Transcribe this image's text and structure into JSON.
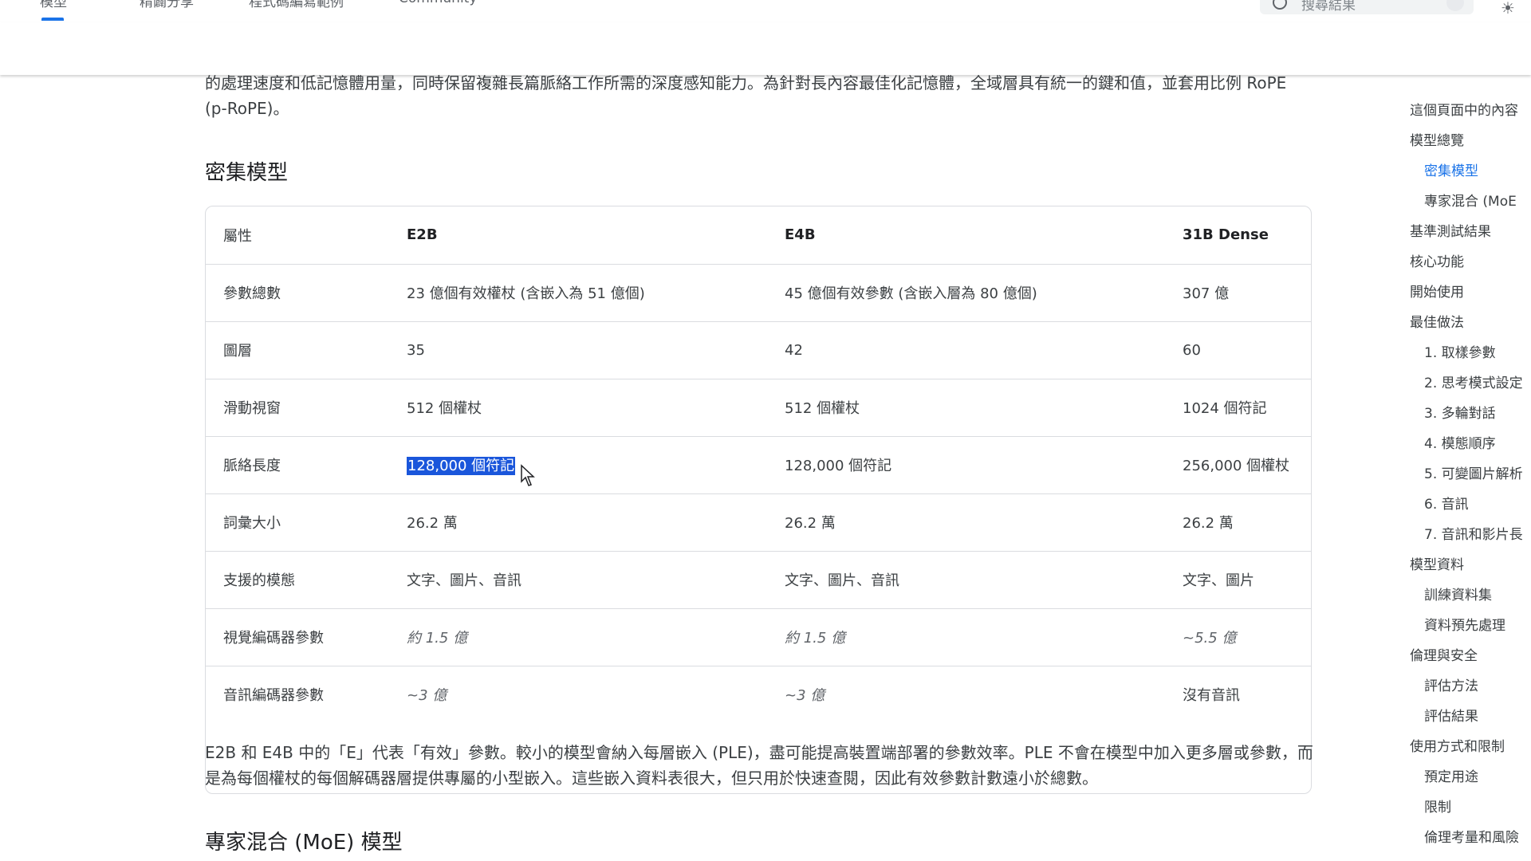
{
  "topnav": {
    "tabs": [
      "模型",
      "精闢分享",
      "程式碼編寫範例",
      "Community"
    ],
    "search_placeholder": "搜尋結果"
  },
  "content": {
    "intro_para": "的處理速度和低記憶體用量，同時保留複雜長篇脈絡工作所需的深度感知能力。為針對長內容最佳化記憶體，全域層具有統一的鍵和值，並套用比例 RoPE (p-RoPE)。",
    "dense_heading": "密集模型",
    "table": {
      "headers": [
        "屬性",
        "E2B",
        "E4B",
        "31B Dense"
      ],
      "rows": [
        [
          "參數總數",
          "23 億個有效權杖 (含嵌入為 51 億個)",
          "45 億個有效參數 (含嵌入層為 80 億個)",
          "307 億"
        ],
        [
          "圖層",
          "35",
          "42",
          "60"
        ],
        [
          "滑動視窗",
          "512 個權杖",
          "512 個權杖",
          "1024 個符記"
        ],
        [
          "脈絡長度",
          "128,000 個符記",
          "128,000 個符記",
          "256,000 個權杖"
        ],
        [
          "詞彙大小",
          "26.2 萬",
          "26.2 萬",
          "26.2 萬"
        ],
        [
          "支援的模態",
          "文字、圖片、音訊",
          "文字、圖片、音訊",
          "文字、圖片"
        ],
        [
          "視覺編碼器參數",
          "約 1.5 億",
          "約 1.5 億",
          "~5.5 億"
        ],
        [
          "音訊編碼器參數",
          "~3 億",
          "~3 億",
          "沒有音訊"
        ]
      ]
    },
    "e_note": "E2B 和 E4B 中的「E」代表「有效」參數。較小的模型會納入每層嵌入 (PLE)，盡可能提高裝置端部署的參數效率。PLE 不會在模型中加入更多層或參數，而是為每個權杖的每個解碼器層提供專屬的小型嵌入。這些嵌入資料表很大，但只用於快速查閱，因此有效參數計數遠小於總數。",
    "moe_heading": "專家混合 (MoE) 模型"
  },
  "toc": {
    "title": "這個頁面中的內容",
    "items": [
      {
        "label": "模型總覽",
        "level": 0
      },
      {
        "label": "密集模型",
        "level": 1,
        "active": true
      },
      {
        "label": "專家混合 (MoE",
        "level": 1
      },
      {
        "label": "基準測試結果",
        "level": 0
      },
      {
        "label": "核心功能",
        "level": 0
      },
      {
        "label": "開始使用",
        "level": 0
      },
      {
        "label": "最佳做法",
        "level": 0
      },
      {
        "label": "1. 取樣參數",
        "level": 1
      },
      {
        "label": "2. 思考模式設定",
        "level": 1
      },
      {
        "label": "3. 多輪對話",
        "level": 1
      },
      {
        "label": "4. 模態順序",
        "level": 1
      },
      {
        "label": "5. 可變圖片解析",
        "level": 1
      },
      {
        "label": "6. 音訊",
        "level": 1
      },
      {
        "label": "7. 音訊和影片長",
        "level": 1
      },
      {
        "label": "模型資料",
        "level": 0
      },
      {
        "label": "訓練資料集",
        "level": 1
      },
      {
        "label": "資料預先處理",
        "level": 1
      },
      {
        "label": "倫理與安全",
        "level": 0
      },
      {
        "label": "評估方法",
        "level": 1
      },
      {
        "label": "評估結果",
        "level": 1
      },
      {
        "label": "使用方式和限制",
        "level": 0
      },
      {
        "label": "預定用途",
        "level": 1
      },
      {
        "label": "限制",
        "level": 1
      },
      {
        "label": "倫理考量和風險",
        "level": 1
      }
    ]
  },
  "colors": {
    "accent": "#1a73e8",
    "selection": "#1a56db"
  }
}
